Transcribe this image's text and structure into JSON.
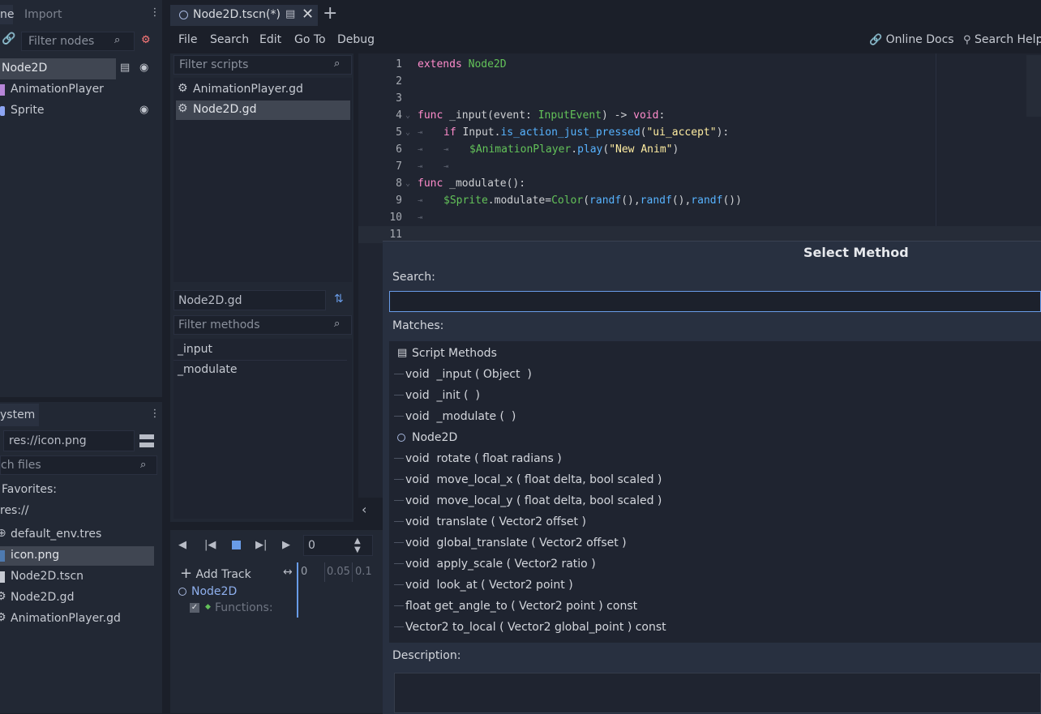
{
  "scene_dock": {
    "tab_scene": "ne",
    "tab_import": "Import",
    "filter_placeholder": "Filter nodes",
    "nodes": [
      "Node2D",
      "AnimationPlayer",
      "Sprite"
    ]
  },
  "filesystem": {
    "tab": "ystem",
    "path": "res://icon.png",
    "search_placeholder": "ch files",
    "favorites": "Favorites:",
    "root": "res://",
    "files": [
      "default_env.tres",
      "icon.png",
      "Node2D.tscn",
      "Node2D.gd",
      "AnimationPlayer.gd"
    ]
  },
  "editor_tab": {
    "label": "Node2D.tscn(*)"
  },
  "menu": {
    "items": [
      "File",
      "Search",
      "Edit",
      "Go To",
      "Debug"
    ],
    "online_docs": "Online Docs",
    "search_help": "Search Help"
  },
  "scripts_panel": {
    "filter_placeholder": "Filter scripts",
    "scripts": [
      "AnimationPlayer.gd",
      "Node2D.gd"
    ],
    "current_script": "Node2D.gd",
    "methods_placeholder": "Filter methods",
    "methods": [
      "_input",
      "_modulate"
    ]
  },
  "code": {
    "line_numbers": [
      "1",
      "2",
      "3",
      "4",
      "5",
      "6",
      "7",
      "8",
      "9",
      "10",
      "11"
    ],
    "l1": {
      "kw": "extends",
      "cls": "Node2D"
    },
    "l4": {
      "kw": "func",
      "name": " _input(event: ",
      "type": "InputEvent",
      "rest": ") -> ",
      "ret": "void",
      "end": ":"
    },
    "l5": {
      "kw": "if",
      "obj": " Input.",
      "call": "is_action_just_pressed",
      "open": "(",
      "str": "\"ui_accept\"",
      "close": "):"
    },
    "l6": {
      "node": "$AnimationPlayer",
      "dot": ".",
      "call": "play",
      "open": "(",
      "str": "\"New Anim\"",
      "close": ")"
    },
    "l8": {
      "kw": "func",
      "name": " _modulate",
      "rest": "():"
    },
    "l9": {
      "node": "$Sprite",
      "mid": ".modulate=",
      "cls": "Color",
      "open": "(",
      "f1": "randf",
      "p1": "(),",
      "f2": "randf",
      "p2": "(),",
      "f3": "randf",
      "p3": "())"
    }
  },
  "animation": {
    "frame": "0",
    "add_track": "Add Track",
    "timeline": [
      "0",
      "0.05",
      "0.1"
    ],
    "track_node": "Node2D",
    "track_functions": "Functions:"
  },
  "dialog": {
    "title": "Select Method",
    "search_label": "Search:",
    "search_value": "",
    "matches_label": "Matches:",
    "group_script": "Script Methods",
    "script_methods": [
      "void  _input ( Object  )",
      "void  _init (  )",
      "void  _modulate (  )"
    ],
    "group_node": "Node2D",
    "node_methods": [
      "void  rotate ( float radians )",
      "void  move_local_x ( float delta, bool scaled )",
      "void  move_local_y ( float delta, bool scaled )",
      "void  translate ( Vector2 offset )",
      "void  global_translate ( Vector2 offset )",
      "void  apply_scale ( Vector2 ratio )",
      "void  look_at ( Vector2 point )",
      "float get_angle_to ( Vector2 point ) const",
      "Vector2 to_local ( Vector2 global_point ) const"
    ],
    "description_label": "Description:"
  },
  "colors": {
    "accent": "#699ce8",
    "bg": "#1b1f29",
    "panel": "#222834",
    "selection": "#404652"
  }
}
